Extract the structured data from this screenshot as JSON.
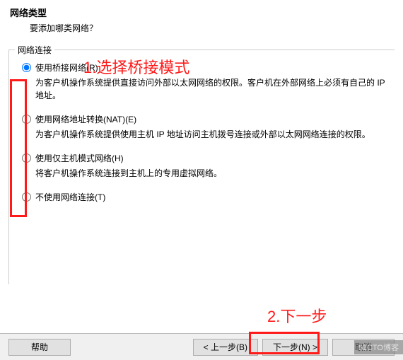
{
  "header": {
    "title": "网络类型",
    "subtitle": "要添加哪类网络？"
  },
  "fieldset": {
    "legend": "网络连接"
  },
  "options": {
    "bridged": {
      "label": "使用桥接网络(R)",
      "desc": "为客户机操作系统提供直接访问外部以太网网络的权限。客户机在外部网络上必须有自己的 IP 地址。"
    },
    "nat": {
      "label": "使用网络地址转换(NAT)(E)",
      "desc": "为客户机操作系统提供使用主机 IP 地址访问主机拨号连接或外部以太网网络连接的权限。"
    },
    "hostonly": {
      "label": "使用仅主机模式网络(H)",
      "desc": "将客户机操作系统连接到主机上的专用虚拟网络。"
    },
    "none": {
      "label": "不使用网络连接(T)"
    }
  },
  "buttons": {
    "help": "帮助",
    "back": "< 上一步(B)",
    "next": "下一步(N) >",
    "cancel": "取消"
  },
  "annotations": {
    "step1": "1.选择桥接模式",
    "step2": "2.下一步"
  },
  "watermark": "51CTO博客"
}
